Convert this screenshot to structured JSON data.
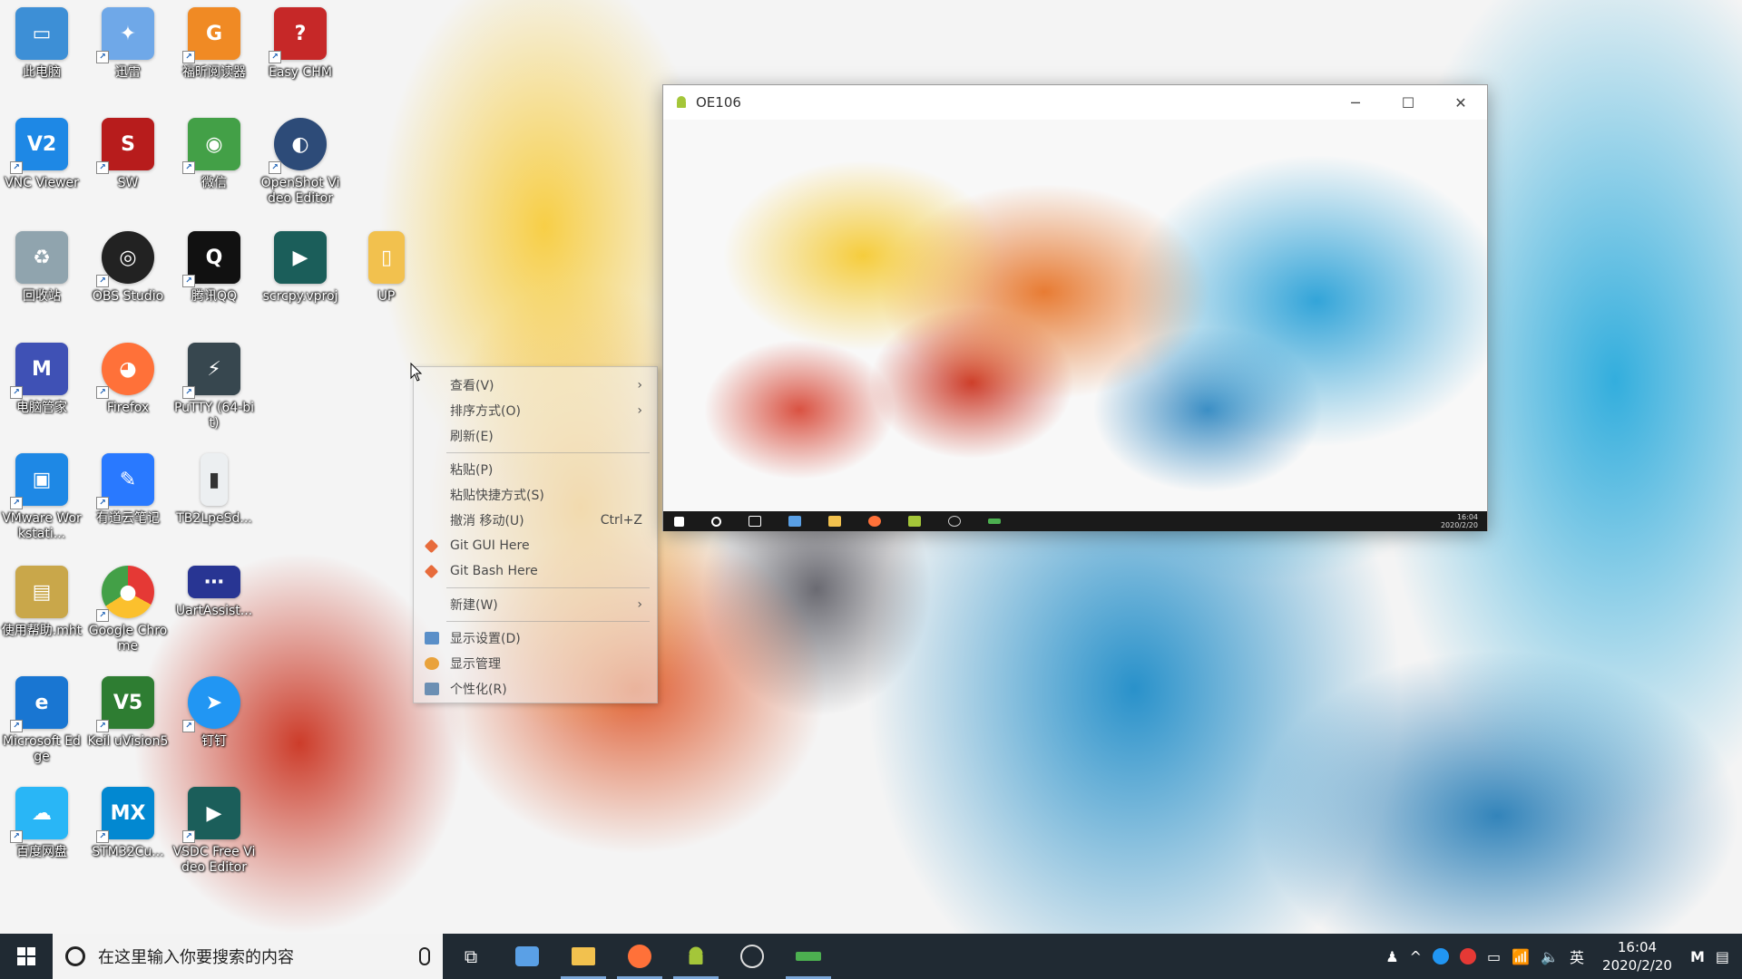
{
  "desktop": {
    "icons": [
      {
        "label": "此电脑",
        "color": "#3d8fd6",
        "icon": "computer-icon"
      },
      {
        "label": "迅雷",
        "color": "#6fa8e8",
        "icon": "thunder-bird-icon"
      },
      {
        "label": "福昕阅读器",
        "color": "#f08a24",
        "icon": "pdf-icon"
      },
      {
        "label": "Easy CHM",
        "color": "#c62828",
        "icon": "help-book-icon"
      },
      {
        "label": "VNC Viewer",
        "color": "#1e88e5",
        "icon": "vnc-icon"
      },
      {
        "label": "SW",
        "color": "#b71c1c",
        "icon": "solidworks-icon"
      },
      {
        "label": "微信",
        "color": "#43a047",
        "icon": "wechat-icon"
      },
      {
        "label": "OpenShot Video Editor",
        "color": "#2d4b78",
        "icon": "openshot-icon"
      },
      {
        "label": "回收站",
        "color": "#90a4ae",
        "icon": "recycle-bin-icon"
      },
      {
        "label": "OBS Studio",
        "color": "#222222",
        "icon": "obs-icon"
      },
      {
        "label": "腾讯QQ",
        "color": "#111111",
        "icon": "qq-penguin-icon"
      },
      {
        "label": "scrcpy.vproj",
        "color": "#1b5e5a",
        "icon": "vsdc-project-icon"
      },
      {
        "label": "UP",
        "color": "#f2c14e",
        "icon": "folder-icon"
      },
      {
        "label": "电脑管家",
        "color": "#3f51b5",
        "icon": "pc-manager-icon"
      },
      {
        "label": "Firefox",
        "color": "#ff7139",
        "icon": "firefox-icon"
      },
      {
        "label": "PuTTY (64-bit)",
        "color": "#37474f",
        "icon": "putty-icon"
      },
      {
        "label": "VMware Workstati...",
        "color": "#1e88e5",
        "icon": "vmware-icon"
      },
      {
        "label": "有道云笔记",
        "color": "#2979ff",
        "icon": "youdao-note-icon"
      },
      {
        "label": "TB2LpeSd...",
        "color": "#eceff1",
        "icon": "file-icon"
      },
      {
        "label": "使用帮助.mht",
        "color": "#c9a74a",
        "icon": "mht-file-icon"
      },
      {
        "label": "Google Chrome",
        "color": "#4caf50",
        "icon": "chrome-icon"
      },
      {
        "label": "UartAssist...",
        "color": "#283593",
        "icon": "serial-port-icon"
      },
      {
        "label": "Microsoft Edge",
        "color": "#1976d2",
        "icon": "edge-icon"
      },
      {
        "label": "Keil uVision5",
        "color": "#2e7d32",
        "icon": "keil-icon"
      },
      {
        "label": "钉钉",
        "color": "#2196f3",
        "icon": "dingtalk-icon"
      },
      {
        "label": "百度网盘",
        "color": "#29b6f6",
        "icon": "baidu-netdisk-icon"
      },
      {
        "label": "STM32Cu...",
        "color": "#0288d1",
        "icon": "stm32cube-icon"
      },
      {
        "label": "VSDC Free Video Editor",
        "color": "#1b5e5a",
        "icon": "vsdc-icon"
      }
    ]
  },
  "context_menu": {
    "items": [
      {
        "label": "查看(V)",
        "submenu": true
      },
      {
        "label": "排序方式(O)",
        "submenu": true
      },
      {
        "label": "刷新(E)"
      },
      {
        "separator": true
      },
      {
        "label": "粘贴(P)"
      },
      {
        "label": "粘贴快捷方式(S)"
      },
      {
        "label": "撤消 移动(U)",
        "shortcut": "Ctrl+Z"
      },
      {
        "label": "Git GUI Here",
        "icon": "git-icon"
      },
      {
        "label": "Git Bash Here",
        "icon": "git-icon"
      },
      {
        "separator": true
      },
      {
        "label": "新建(W)",
        "submenu": true
      },
      {
        "separator": true
      },
      {
        "label": "显示设置(D)",
        "icon": "display-icon"
      },
      {
        "label": "显示管理",
        "icon": "display-manager-icon"
      },
      {
        "label": "个性化(R)",
        "icon": "personalize-icon"
      }
    ]
  },
  "window": {
    "title": "OE106",
    "minimize": "─",
    "maximize": "☐",
    "close": "✕",
    "mirrored_clock_time": "16:04",
    "mirrored_clock_date": "2020/2/20"
  },
  "taskbar": {
    "search_placeholder": "在这里输入你要搜索的内容",
    "task_view": "⧉",
    "apps": [
      {
        "icon": "thunder-icon",
        "color": "#5aa0e6",
        "active": false
      },
      {
        "icon": "file-explorer-icon",
        "color": "#f2c14e",
        "active": true
      },
      {
        "icon": "firefox-icon",
        "color": "#ff7139",
        "active": true
      },
      {
        "icon": "android-icon",
        "color": "#a4c639",
        "active": true
      },
      {
        "icon": "obs-icon",
        "color": "#dddddd",
        "active": false
      },
      {
        "icon": "scrcpy-icon",
        "color": "#4caf50",
        "active": true
      }
    ],
    "tray": {
      "people": "♟",
      "chevron": "^",
      "ime": "英",
      "volume": "🔈",
      "network": "📶",
      "battery": "▭"
    },
    "clock_time": "16:04",
    "clock_date": "2020/2/20"
  }
}
